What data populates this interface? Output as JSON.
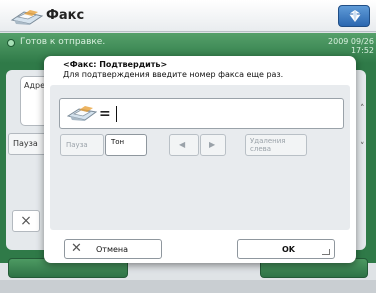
{
  "app": {
    "title": "Факс",
    "status_text": "Готов к отправке.",
    "status_time_date": "2009 09/26",
    "status_time_clock": "17:52"
  },
  "background": {
    "addr_label": "Адре",
    "pause_label": "Паузa",
    "close_symbol": "×",
    "right_up": "˄",
    "right_down": "˅"
  },
  "dialog": {
    "title": "<Факс: Подтвердить>",
    "instruction": "Для подтверждения введите номер факса еще раз.",
    "input": {
      "prefix_symbol": "=",
      "value": ""
    },
    "buttons": {
      "pause": "Пауза",
      "tone": "Тон",
      "left_arrow": "◀",
      "right_arrow": "▶",
      "delete_line1": "Удаления",
      "delete_line2": "слева"
    },
    "cancel_icon": "✕",
    "cancel_label": "Отмена",
    "ok_label": "OK"
  },
  "colors": {
    "status_green": "#2f7a48",
    "accent_blue": "#2b67b0"
  },
  "icons": {
    "fax_logo": "fax-machine-icon",
    "corner_button": "gem-icon",
    "input_prefix": "fax-machine-icon"
  }
}
